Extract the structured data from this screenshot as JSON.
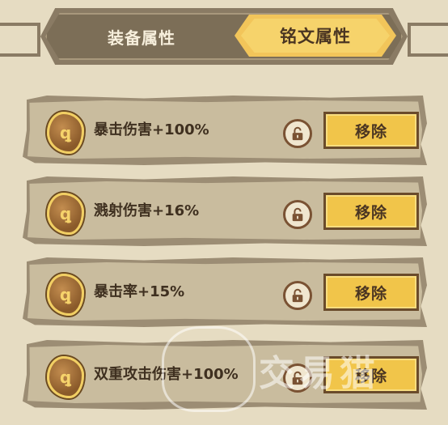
{
  "tabs": {
    "equipment_label": "装备属性",
    "inscription_label": "铭文属性",
    "active": "铭文属性"
  },
  "attributes": [
    {
      "text": "暴击伤害+100%",
      "rune_glyph": "ꝗ",
      "lock_icon": "unlock-icon",
      "remove_label": "移除"
    },
    {
      "text": "溅射伤害+16%",
      "rune_glyph": "ꝗ",
      "lock_icon": "unlock-icon",
      "remove_label": "移除"
    },
    {
      "text": "暴击率+15%",
      "rune_glyph": "ꝗ",
      "lock_icon": "unlock-icon",
      "remove_label": "移除"
    },
    {
      "text": "双重攻击伤害+100%",
      "rune_glyph": "ꝗ",
      "lock_icon": "unlock-icon",
      "remove_label": "移除"
    }
  ],
  "watermark": {
    "text": "交易猫"
  },
  "colors": {
    "background": "#e6dcc2",
    "tab_active": "#f6d36b",
    "remove_button": "#f1c54a",
    "row_panel": "#c9bc9e",
    "text_dark": "#3f3020"
  }
}
